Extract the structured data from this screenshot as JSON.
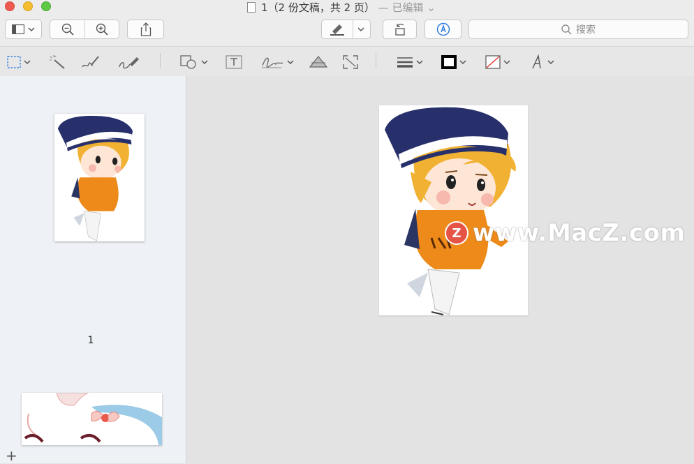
{
  "window": {
    "title": "1（2 份文稿，共 2 页）",
    "title_state": "— 已编辑",
    "traffic_lights": {
      "close": "#ee5a52",
      "minimize": "#f5be30",
      "zoom": "#5ec945"
    }
  },
  "toolbar": {
    "sidebar_icon": "sidebar-toggle-icon",
    "zoom_out_icon": "zoom-out-icon",
    "zoom_in_icon": "zoom-in-icon",
    "share_icon": "share-icon",
    "highlight_icon": "highlighter-icon",
    "rotate_icon": "rotate-icon",
    "markup_icon": "markup-pen-icon",
    "search_placeholder": "搜索"
  },
  "markup_toolbar": {
    "tools": [
      "selection-rect-icon",
      "instant-alpha-icon",
      "sketch-icon",
      "draw-icon",
      "shapes-icon",
      "text-box-icon",
      "signature-icon",
      "adjust-color-icon",
      "adjust-size-icon",
      "line-style-icon",
      "border-color-icon",
      "fill-color-icon",
      "text-style-icon"
    ]
  },
  "sidebar": {
    "pages": [
      {
        "label": "1"
      }
    ],
    "add_label": "+"
  },
  "watermark": {
    "badge": "Z",
    "text": "www.MacZ.com",
    "badge_color": "#e65447"
  }
}
